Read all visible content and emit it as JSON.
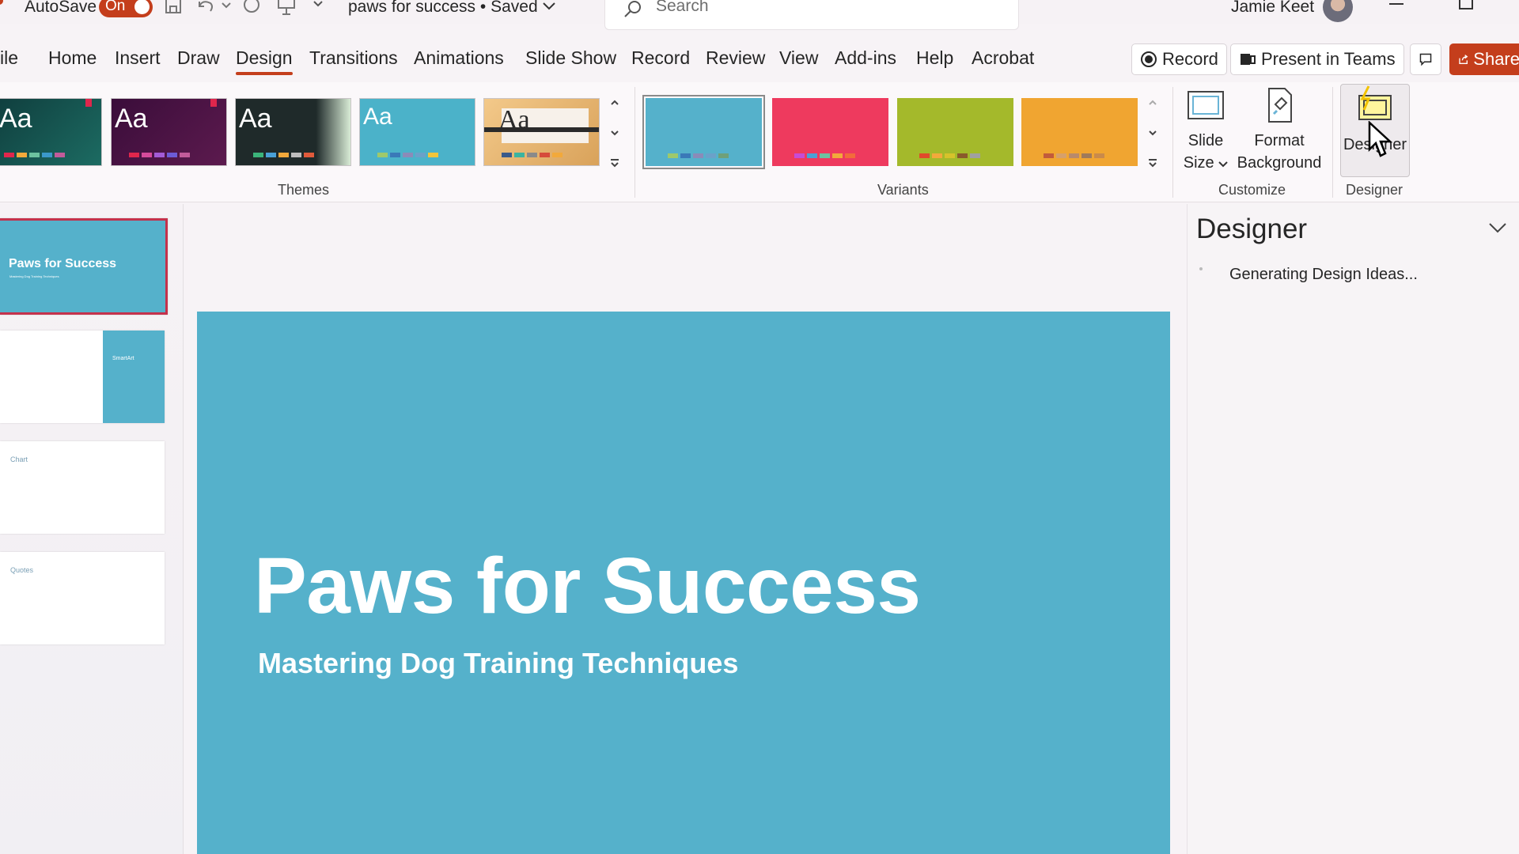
{
  "titlebar": {
    "autosave_label": "AutoSave",
    "autosave_state": "On",
    "document_title": "paws for success • Saved",
    "search_placeholder": "Search",
    "user_name": "Jamie Keet"
  },
  "menu": {
    "file_label": "ile",
    "tabs": [
      "Home",
      "Insert",
      "Draw",
      "Design",
      "Transitions",
      "Animations",
      "Slide Show",
      "Record",
      "Review",
      "View",
      "Add-ins",
      "Help",
      "Acrobat"
    ],
    "active_tab": "Design",
    "record_button": "Record",
    "present_button": "Present in Teams",
    "share_button": "Share"
  },
  "ribbon": {
    "themes_label": "Themes",
    "theme_sample_text": "Aa",
    "variants_label": "Variants",
    "customize_label": "Customize",
    "designer_group_label": "Designer",
    "slide_size_line1": "Slide",
    "slide_size_line2": "Size",
    "format_background_line1": "Format",
    "format_background_line2": "Background",
    "designer_button": "Designer",
    "variant_colors": [
      "#55b1cb",
      "#ee3a5e",
      "#a4b92b",
      "#f0a531"
    ]
  },
  "slides": {
    "thumb1_title": "Paws for Success",
    "thumb1_subtitle": "Mastering Dog Training Techniques",
    "thumb2_label": "SmartArt",
    "thumb3_label": "Chart",
    "thumb4_label": "Quotes"
  },
  "slide": {
    "title": "Paws for Success",
    "subtitle": "Mastering Dog Training Techniques",
    "background": "#55b1cb"
  },
  "designer_pane": {
    "title": "Designer",
    "status": "Generating Design Ideas..."
  }
}
